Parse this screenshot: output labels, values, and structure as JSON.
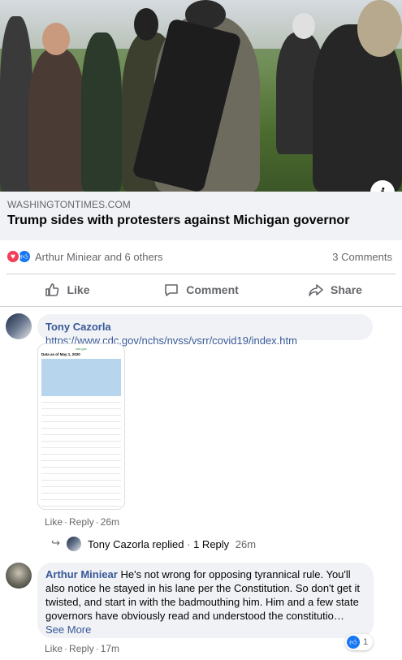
{
  "link_preview": {
    "domain": "WASHINGTONTIMES.COM",
    "title": "Trump sides with protesters against Michigan governor"
  },
  "reactions": {
    "summary": "Arthur Miniear and 6 others",
    "comment_count": "3 Comments",
    "types": [
      "love",
      "like"
    ]
  },
  "actions": {
    "like": "Like",
    "comment": "Comment",
    "share": "Share"
  },
  "comments": [
    {
      "author": "Tony Cazorla",
      "text": "https://www.cdc.gov/nchs/nvss/vsrr/covid19/index.htm",
      "attachment": {
        "site": "cdc.gov",
        "caption": "Data as of May 1, 2020"
      },
      "like_label": "Like",
      "reply_label": "Reply",
      "time": "26m",
      "replies_summary": {
        "text": "Tony Cazorla replied",
        "count": "1 Reply",
        "time": "26m"
      }
    },
    {
      "author": "Arthur Miniear",
      "text": "He's not wrong for opposing tyrannical rule. You'll also notice he stayed in his lane per the Constitution. So don't get it twisted, and start in with the badmouthing him. Him and a few state governors have obviously read and understood the constitutio…",
      "see_more": "See More",
      "like_label": "Like",
      "reply_label": "Reply",
      "time": "17m",
      "reaction_count": "1"
    }
  ],
  "icons": {
    "info": "info-icon",
    "like": "thumbs-up-icon",
    "comment": "speech-bubble-icon",
    "share": "share-arrow-icon",
    "reply": "reply-arrow-icon"
  },
  "colors": {
    "link_blue": "#385898",
    "fb_blue": "#1877f2",
    "love_red": "#f33e58",
    "bubble_bg": "#f0f2f5",
    "muted_text": "#65676b"
  }
}
